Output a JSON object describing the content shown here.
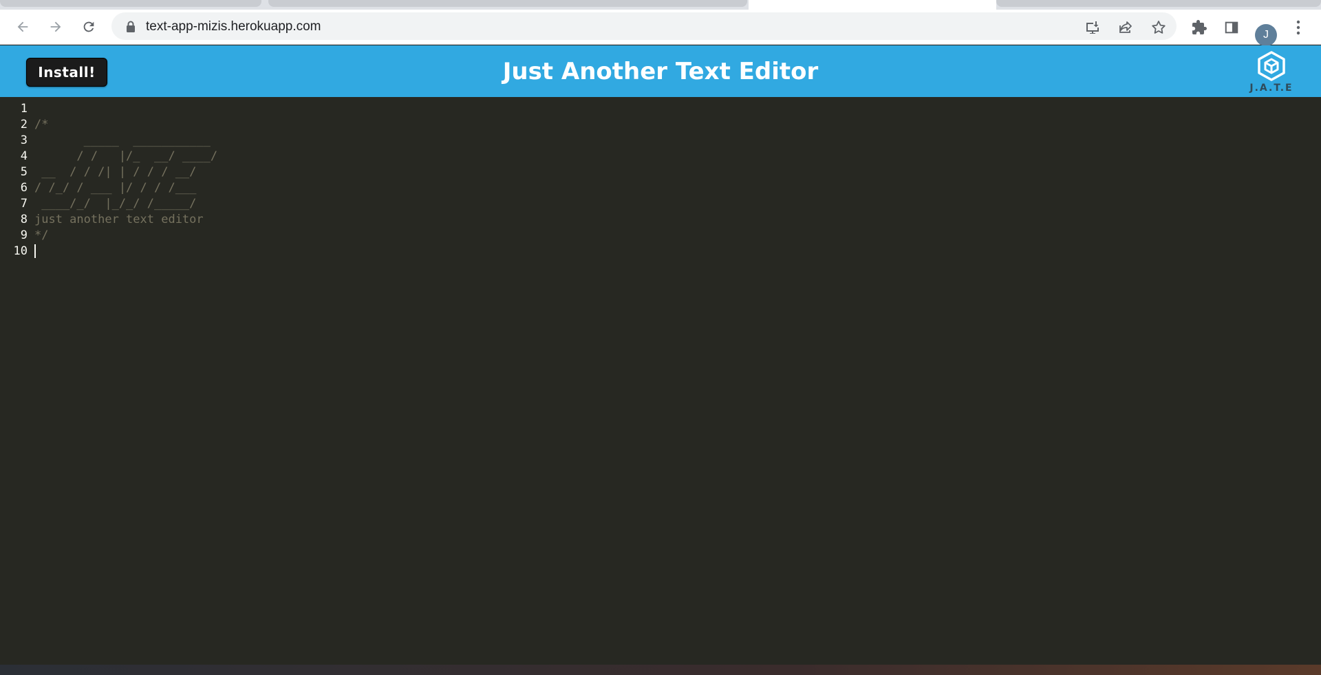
{
  "browser": {
    "url": "text-app-mizis.herokuapp.com",
    "avatar_initial": "J",
    "icons": {
      "back": "arrow-left-icon",
      "forward": "arrow-right-icon",
      "reload": "reload-icon",
      "lock": "lock-icon",
      "install": "install-app-icon",
      "share": "share-icon",
      "bookmark": "star-icon",
      "extensions": "puzzle-icon",
      "side_panel": "side-panel-icon",
      "menu": "kebab-menu-icon"
    }
  },
  "app": {
    "install_label": "Install!",
    "title": "Just Another Text Editor",
    "logo_text": "J.A.T.E",
    "accent_color": "#31a9e1"
  },
  "editor": {
    "line_numbers": [
      "1",
      "2",
      "3",
      "4",
      "5",
      "6",
      "7",
      "8",
      "9",
      "10"
    ],
    "lines": [
      "",
      "/*",
      "       _____  ___________",
      "      / /   |/_  __/ ____/",
      " __  / / /| | / / / __/",
      "/ /_/ / ___ |/ / / /___",
      " ____/_/  |_/_/ /_____/",
      "just another text editor",
      "*/",
      ""
    ],
    "background_color": "#272822",
    "comment_color": "#75715e"
  }
}
